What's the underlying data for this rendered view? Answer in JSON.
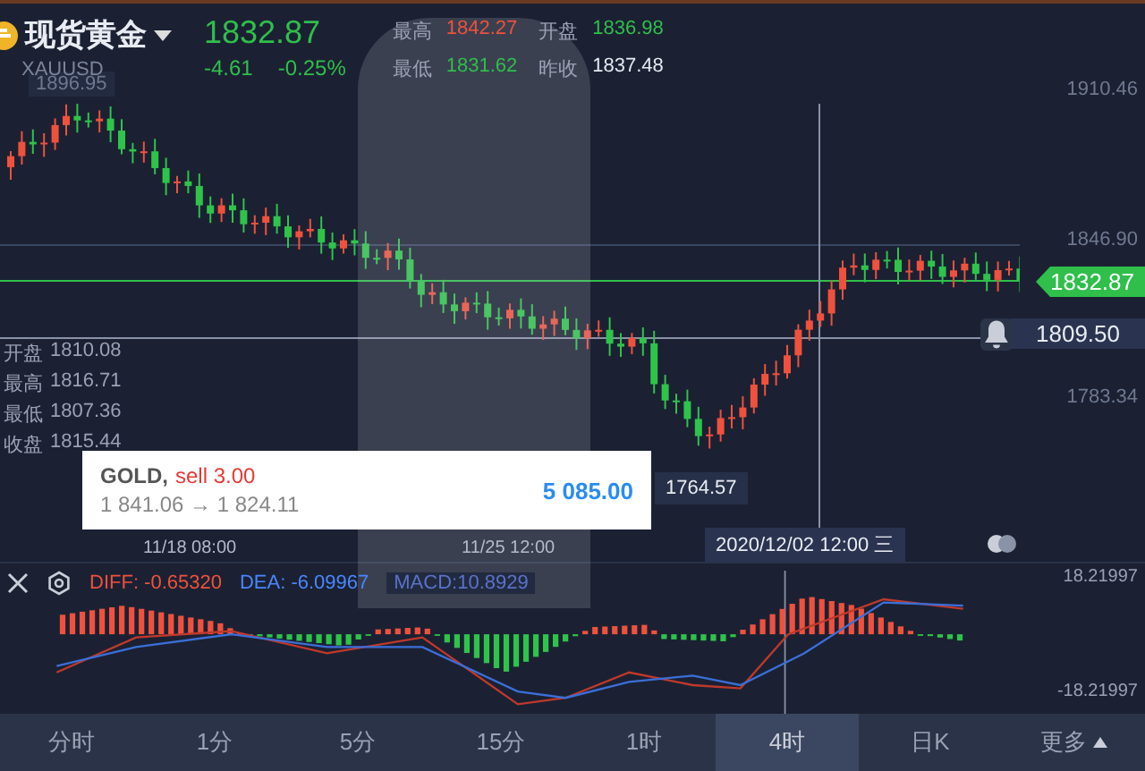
{
  "header": {
    "name": "现货黄金",
    "symbol": "XAUUSD",
    "price": "1832.87",
    "change": "-4.61",
    "change_pct": "-0.25%",
    "stats": [
      {
        "label": "最高",
        "value": "1842.27",
        "color": "#f0513c"
      },
      {
        "label": "开盘",
        "value": "1836.98",
        "color": "#2fbf4a"
      },
      {
        "label": "最低",
        "value": "1831.62",
        "color": "#2fbf4a"
      },
      {
        "label": "昨收",
        "value": "1837.48",
        "color": "#e6e9f0"
      }
    ]
  },
  "chart": {
    "y_labels": [
      "1910.46",
      "1846.90",
      "1783.34"
    ],
    "top_marker": "1896.95",
    "current_price": "1832.87",
    "alert_price": "1809.50",
    "low_marker": "1764.57",
    "ohlc": [
      {
        "label": "开盘",
        "value": "1810.08"
      },
      {
        "label": "最高",
        "value": "1816.71"
      },
      {
        "label": "最低",
        "value": "1807.36"
      },
      {
        "label": "收盘",
        "value": "1815.44"
      }
    ],
    "x_labels": [
      "11/18 08:00",
      "11/25 12:00"
    ],
    "crosshair_time": "2020/12/02 12:00 三"
  },
  "notification": {
    "symbol": "GOLD,",
    "action": "sell 3.00",
    "route": "1 841.06 → 1 824.11",
    "amount": "5 085.00"
  },
  "macd": {
    "diff": "DIFF: -0.65320",
    "dea": "DEA: -6.09967",
    "macd": "MACD:10.8929",
    "max": "18.21997",
    "min": "-18.21997"
  },
  "periods": [
    {
      "label": "分时",
      "selected": false
    },
    {
      "label": "1分",
      "selected": false
    },
    {
      "label": "5分",
      "selected": false
    },
    {
      "label": "15分",
      "selected": false
    },
    {
      "label": "1时",
      "selected": false
    },
    {
      "label": "4时",
      "selected": true
    },
    {
      "label": "日K",
      "selected": false
    },
    {
      "label": "更多",
      "selected": false
    }
  ]
}
